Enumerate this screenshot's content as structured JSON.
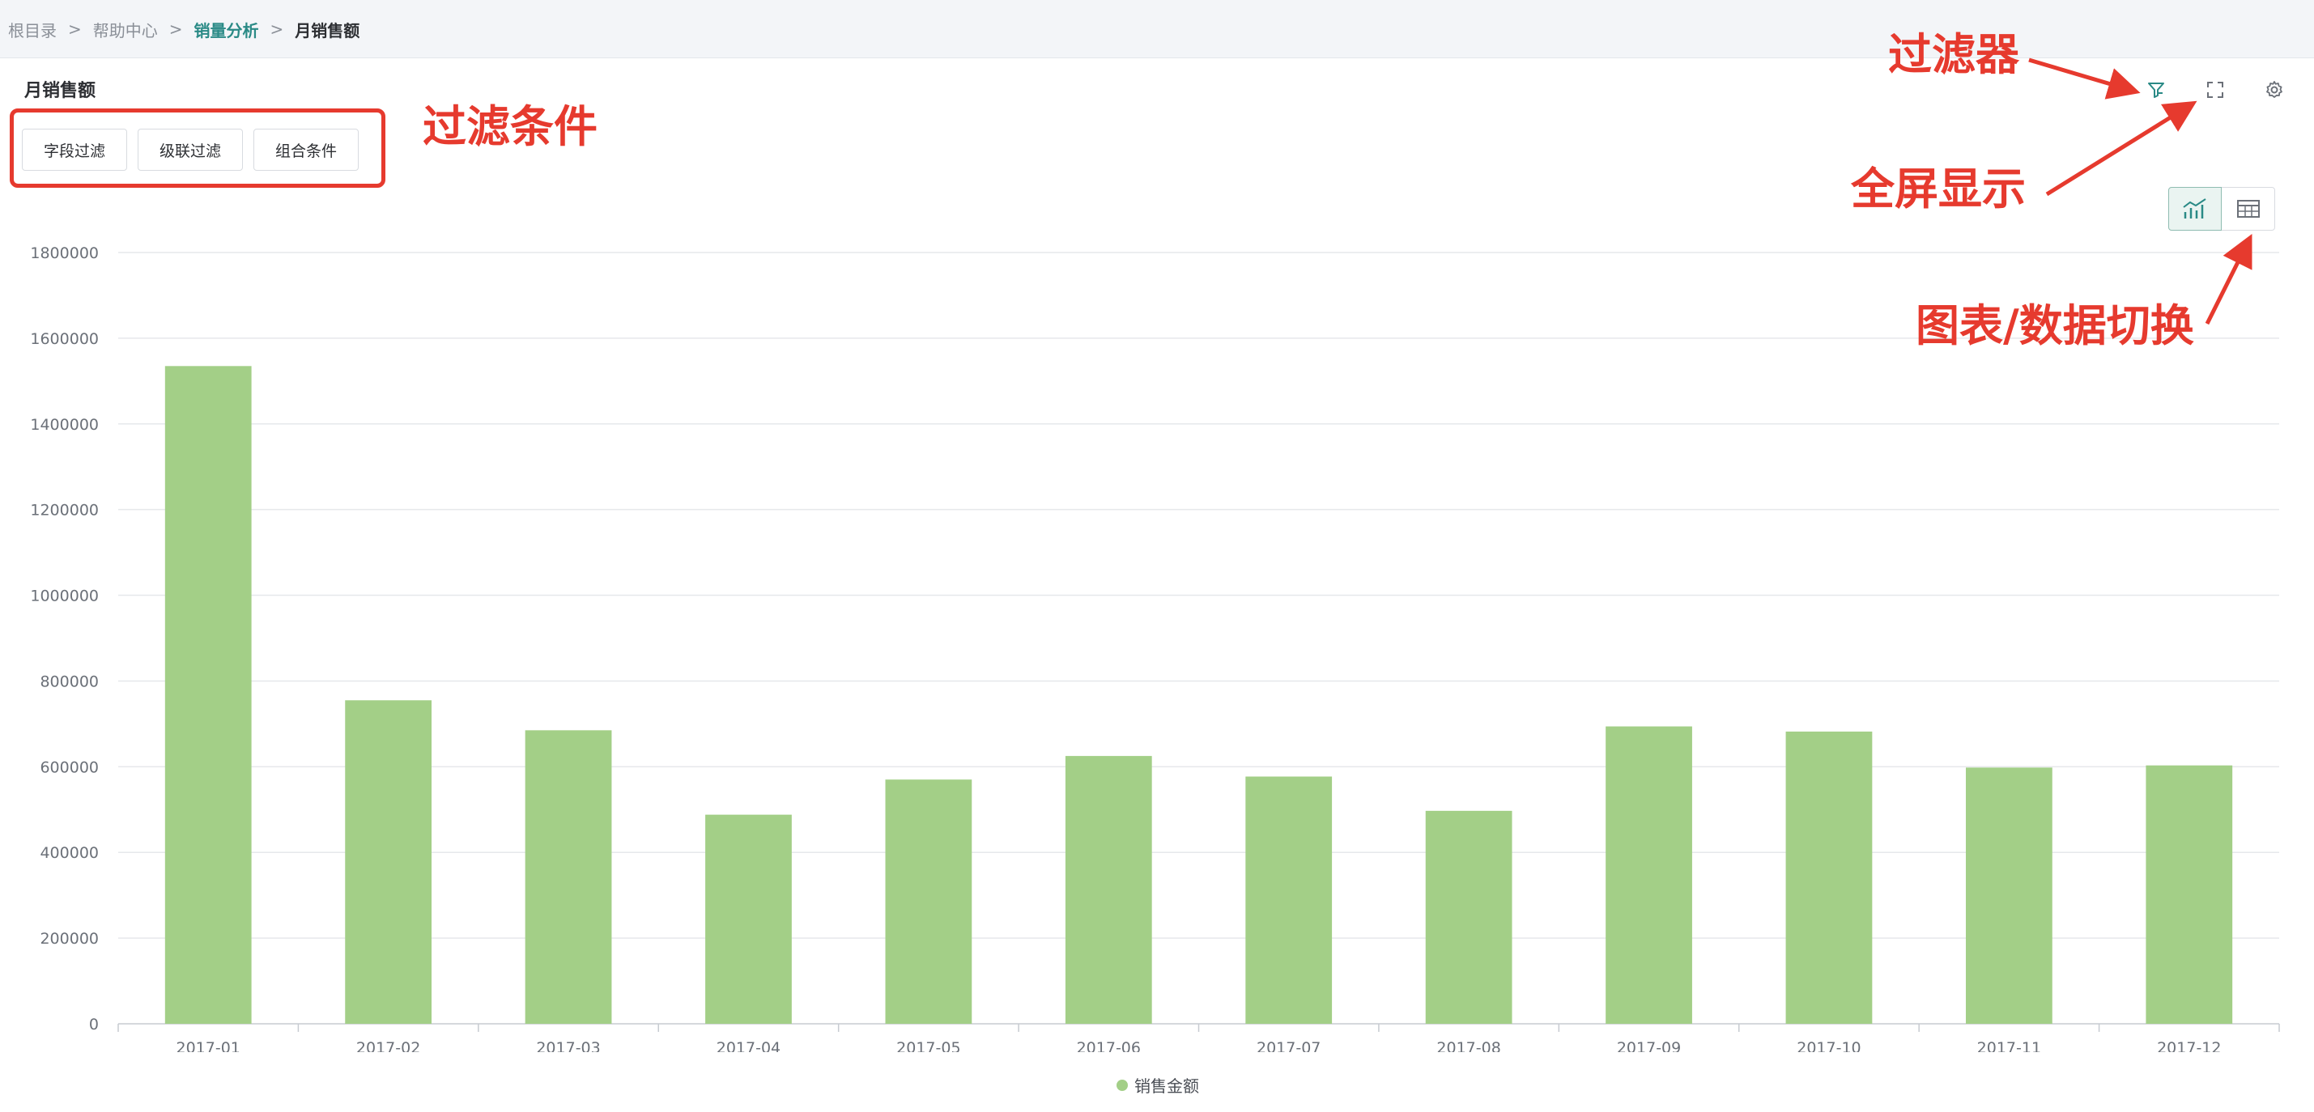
{
  "breadcrumb": {
    "items": [
      "根目录",
      "帮助中心",
      "销量分析",
      "月销售额"
    ],
    "separator": ">"
  },
  "panel": {
    "title": "月销售额"
  },
  "filters": {
    "buttons": [
      "字段过滤",
      "级联过滤",
      "组合条件"
    ]
  },
  "toolbar": {
    "icons": [
      "filter-icon",
      "fullscreen-icon",
      "settings-icon"
    ],
    "view_switch": {
      "options": [
        "chart-view-icon",
        "table-view-icon"
      ],
      "active": "chart-view-icon"
    }
  },
  "annotations": {
    "filter_conditions": "过滤条件",
    "filter": "过滤器",
    "fullscreen": "全屏显示",
    "chart_data_switch": "图表/数据切换"
  },
  "colors": {
    "bar": "#a3cf87",
    "accent": "#2a8a86",
    "annotation": "#e63a2e"
  },
  "chart_data": {
    "type": "bar",
    "categories": [
      "2017-01",
      "2017-02",
      "2017-03",
      "2017-04",
      "2017-05",
      "2017-06",
      "2017-07",
      "2017-08",
      "2017-09",
      "2017-10",
      "2017-11",
      "2017-12"
    ],
    "series": [
      {
        "name": "销售金额",
        "values": [
          1535000,
          755000,
          685000,
          488000,
          570000,
          625000,
          577000,
          497000,
          694000,
          682000,
          598000,
          603000
        ]
      }
    ],
    "ylim": [
      0,
      1800000
    ],
    "yticks": [
      0,
      200000,
      400000,
      600000,
      800000,
      1000000,
      1200000,
      1400000,
      1600000,
      1800000
    ],
    "grid": true,
    "legend": "bottom-center"
  }
}
